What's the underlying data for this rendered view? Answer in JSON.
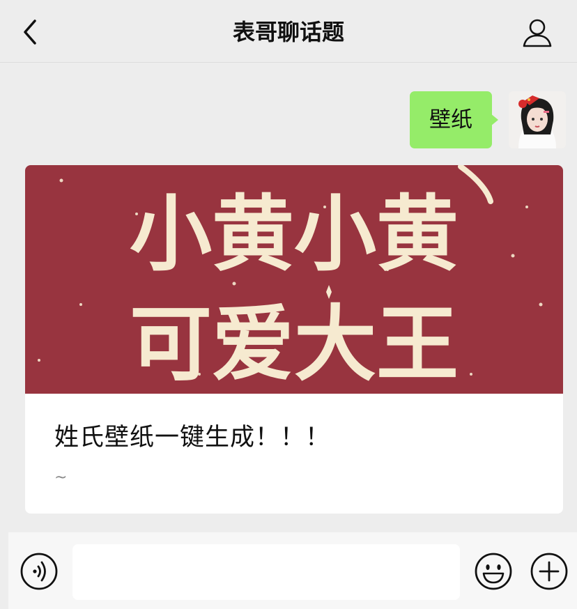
{
  "header": {
    "title": "表哥聊话题",
    "back_icon": "chevron-left-icon",
    "profile_icon": "person-icon"
  },
  "messages": [
    {
      "from": "self",
      "text": "壁纸",
      "avatar": "user-avatar"
    }
  ],
  "card": {
    "cover_text": [
      "小黄小黄",
      "可爱大王"
    ],
    "cover_color": "#98343f",
    "cover_text_color": "#f6ead0",
    "title": "姓氏壁纸一键生成！！！",
    "subtitle": "~"
  },
  "input_bar": {
    "voice_icon": "voice-icon",
    "emoji_icon": "emoji-icon",
    "plus_icon": "plus-icon",
    "input_value": ""
  },
  "colors": {
    "background": "#ededed",
    "bubble_green": "#95ec69"
  }
}
